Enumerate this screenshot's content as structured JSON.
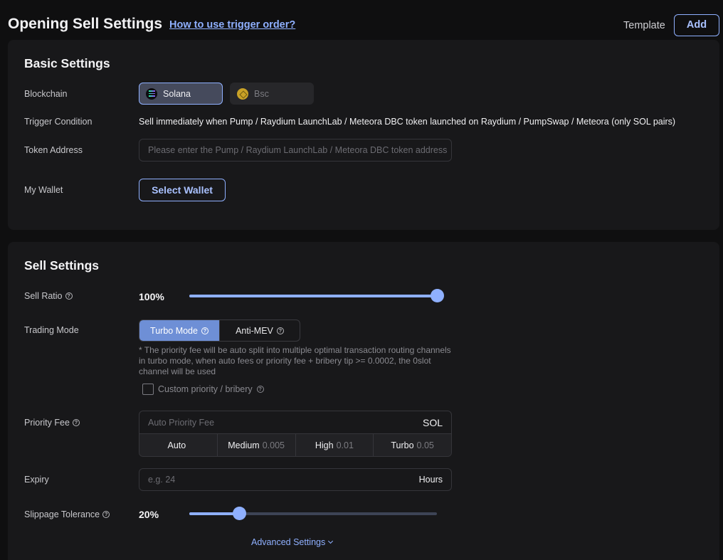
{
  "header": {
    "title": "Opening Sell Settings",
    "help_link": "How to use trigger order?",
    "template_label": "Template",
    "add_label": "Add"
  },
  "basic": {
    "title": "Basic Settings",
    "blockchain_label": "Blockchain",
    "chains": [
      {
        "label": "Solana",
        "icon": "solana-icon",
        "selected": true
      },
      {
        "label": "Bsc",
        "icon": "bsc-icon",
        "selected": false
      }
    ],
    "trigger_label": "Trigger Condition",
    "trigger_text": "Sell immediately when Pump / Raydium LaunchLab / Meteora DBC token launched on Raydium / PumpSwap / Meteora (only SOL pairs)",
    "token_label": "Token Address",
    "token_placeholder": "Please enter the Pump / Raydium LaunchLab / Meteora DBC token address",
    "token_value": "",
    "wallet_label": "My Wallet",
    "wallet_button": "Select Wallet"
  },
  "sell": {
    "title": "Sell Settings",
    "ratio_label": "Sell Ratio",
    "ratio_value": "100%",
    "ratio_level": 1.0,
    "mode_label": "Trading Mode",
    "modes": [
      {
        "label": "Turbo Mode",
        "active": true
      },
      {
        "label": "Anti-MEV",
        "active": false
      }
    ],
    "mode_note": "* The priority fee will be auto split into multiple optimal transaction routing channels in turbo mode, when auto fees or priority fee + bribery tip >= 0.0002, the 0slot channel will be used",
    "custom_label": "Custom priority / bribery",
    "custom_checked": false,
    "fee_label": "Priority Fee",
    "fee_placeholder": "Auto Priority Fee",
    "fee_value": "",
    "fee_unit": "SOL",
    "fee_options": [
      {
        "label": "Auto",
        "value": ""
      },
      {
        "label": "Medium",
        "value": "0.005"
      },
      {
        "label": "High",
        "value": "0.01"
      },
      {
        "label": "Turbo",
        "value": "0.05"
      }
    ],
    "expiry_label": "Expiry",
    "expiry_placeholder": "e.g. 24",
    "expiry_value": "",
    "expiry_unit": "Hours",
    "slippage_label": "Slippage Tolerance",
    "slippage_value": "20%",
    "slippage_level": 0.2,
    "advanced_label": "Advanced Settings"
  },
  "colors": {
    "accent": "#8fb0ff",
    "background": "#0f0f10",
    "card": "#18181a",
    "active_mode": "#6e8fd6"
  }
}
